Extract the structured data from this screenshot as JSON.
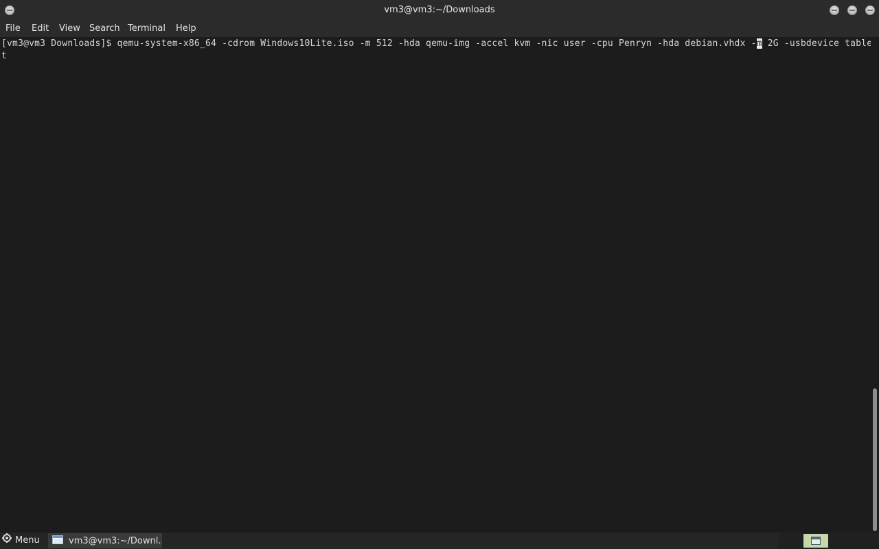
{
  "window": {
    "title": "vm3@vm3:~/Downloads"
  },
  "menubar": {
    "items": [
      "File",
      "Edit",
      "View",
      "Search",
      "Terminal",
      "Help"
    ]
  },
  "terminal": {
    "line1_before_cursor": "[vm3@vm3 Downloads]$ qemu-system-x86_64 -cdrom Windows10Lite.iso -m 512 -hda qemu-img -accel kvm -nic user -cpu Penryn -hda debian.vhdx -",
    "cursor_char": "m",
    "line1_after_cursor": " 2G -usbdevice table",
    "line2": "t"
  },
  "taskbar": {
    "menu_label": "Menu",
    "window_label": "vm3@vm3:~/Downl..."
  },
  "colors": {
    "terminal_bg": "#1c1c1c",
    "terminal_fg": "#d8d8d8",
    "chrome_bg": "#2b2b2b",
    "tray_accent": "#c7d7a8"
  },
  "icons": {
    "window_menu": "window-menu-icon",
    "minimize": "minimize-icon",
    "maximize": "maximize-icon",
    "close": "close-icon",
    "start_menu": "gear-icon",
    "terminal_app": "terminal-icon",
    "show_desktop": "show-desktop-icon"
  }
}
